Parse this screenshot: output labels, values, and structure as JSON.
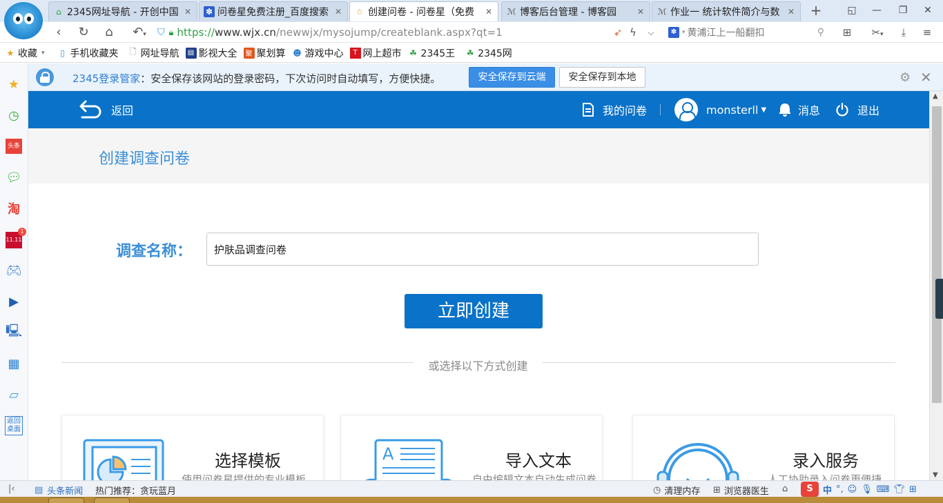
{
  "browser": {
    "tabs": [
      {
        "label": "2345网址导航 - 开创中国",
        "icon": "2345-home-icon"
      },
      {
        "label": "问卷星免费注册_百度搜索",
        "icon": "baidu-paw-icon"
      },
      {
        "label": "创建问卷 - 问卷星（免费",
        "icon": "star-outline-icon",
        "active": true
      },
      {
        "label": "博客后台管理 - 博客园",
        "icon": "cnblogs-icon"
      },
      {
        "label": "作业一 统计软件简介与数",
        "icon": "cnblogs-icon"
      }
    ],
    "url": {
      "protocol": "https://",
      "domain": "www.wjx.cn",
      "path": "/newwjx/mysojump/createblank.aspx?qt=1"
    },
    "search_text": "黄浦江上一船翻扣",
    "bookmarks": [
      {
        "label": "收藏",
        "icon": "star-add-icon",
        "dropdown": true
      },
      {
        "label": "手机收藏夹",
        "icon": "phone-icon"
      },
      {
        "label": "网址导航",
        "icon": "page-icon"
      },
      {
        "label": "影视大全",
        "icon": "film-icon"
      },
      {
        "label": "聚划算",
        "icon": "juhuasuan-icon"
      },
      {
        "label": "游戏中心",
        "icon": "game-icon"
      },
      {
        "label": "网上超市",
        "icon": "tmall-icon"
      },
      {
        "label": "2345王",
        "icon": "2345-icon"
      },
      {
        "label": "2345网",
        "icon": "2345-icon"
      }
    ],
    "password_bar": {
      "brand": "2345登录管家",
      "message": "：安全保存该网站的登录密码，下次访问时自动填写，方便快捷。",
      "save_cloud": "安全保存到云端",
      "save_local": "安全保存到本地"
    },
    "sidebar_badge": "1",
    "sidebar_tail_text": "返回桌面",
    "status": {
      "news": "头条新闻",
      "hot": "热门推荐：贪玩蓝月",
      "clean": "清理内存",
      "doctor": "浏览器医生",
      "ime": "中"
    }
  },
  "site": {
    "header": {
      "back": "返回",
      "my_surveys": "我的问卷",
      "username": "monsterll",
      "messages": "消息",
      "logout": "退出"
    },
    "page_title": "创建调查问卷",
    "form": {
      "label": "调查名称：",
      "value": "护肤品调查问卷",
      "submit": "立即创建"
    },
    "divider_text": "或选择以下方式创建",
    "cards": [
      {
        "title": "选择模板",
        "desc": "使用问卷星提供的专业模板"
      },
      {
        "title": "导入文本",
        "desc": "自由编辑文本自动生成问卷"
      },
      {
        "title": "录入服务",
        "desc": "人工协助录入问卷更便捷"
      }
    ],
    "colors": {
      "brand_blue": "#0a72c8",
      "title_blue": "#3b8fd6"
    }
  }
}
